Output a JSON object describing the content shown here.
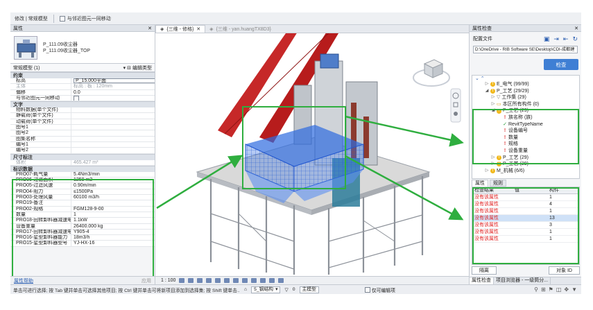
{
  "ribbon": {
    "context": "修改 | 常规模型",
    "checkbox_label": "与邻近图元一同移动"
  },
  "left_panel": {
    "header": "属性",
    "type_name_1": "P_111.09收尘器",
    "type_name_2": "P_111.09收尘器_TOP",
    "type_selector": "常规模型 (1)",
    "edit_type_label": "编辑类型",
    "groups": [
      {
        "name": "约束",
        "rows": [
          {
            "k": "标高",
            "v": "P_15.000平面",
            "input": true
          },
          {
            "k": "主体",
            "v": "标高 : 板 : 120mm",
            "grey": true
          },
          {
            "k": "偏移",
            "v": "0.0"
          },
          {
            "k": "与邻近图元一同移动",
            "v": "",
            "checkbox": true
          }
        ]
      },
      {
        "name": "文字",
        "rows": [
          {
            "k": "物料数据(单个文件)",
            "v": ""
          },
          {
            "k": "静载荷(单个文件)",
            "v": ""
          },
          {
            "k": "动载荷(单个文件)",
            "v": ""
          },
          {
            "k": "图号1",
            "v": ""
          },
          {
            "k": "图号2",
            "v": ""
          },
          {
            "k": "图集名称",
            "v": ""
          },
          {
            "k": "编号1",
            "v": ""
          },
          {
            "k": "编号2",
            "v": ""
          }
        ]
      },
      {
        "name": "尺寸标注",
        "rows": [
          {
            "k": "体积",
            "v": "465.427 m³",
            "grey": true
          }
        ]
      },
      {
        "name": "标识数据",
        "rows": [
          {
            "k": "PRO07-耗气量",
            "v": "5.4Nm3/min"
          },
          {
            "k": "PRO06-过滤面积",
            "v": "1259 m2"
          },
          {
            "k": "PRO05-过滤风速",
            "v": "0.90m/min"
          },
          {
            "k": "PRO04-阻力",
            "v": "≤1500Pa"
          },
          {
            "k": "PRO03-处理风量",
            "v": "60100 m3/h"
          },
          {
            "k": "PRO19-备注",
            "v": ""
          },
          {
            "k": "PRO02-规格",
            "v": "FGM128-9-00"
          },
          {
            "k": "数量",
            "v": "1"
          },
          {
            "k": "PRO18-回转卸料器减速电机...",
            "v": "1.1kW"
          },
          {
            "k": "设备重量",
            "v": "26400.000 kg"
          },
          {
            "k": "PRO17-回转卸料器减速电机...",
            "v": "Y905-4"
          },
          {
            "k": "PRO16-星型卸料器能力",
            "v": "18m3/h"
          },
          {
            "k": "PRO15-星型卸料器型号",
            "v": "YJ-HX-16"
          }
        ]
      }
    ],
    "help_link": "属性帮助",
    "apply": "应用"
  },
  "viewport": {
    "tab_active": "{三维 - 修格}",
    "tab_inactive": "{三维 - yan.huangTX8D3}",
    "scale": "1 : 100"
  },
  "right_panel": {
    "header": "属性检查",
    "config_label": "配置文件",
    "path": "D:\\OneDrive - RIB Software SE\\Desktop\\CDI-成都建",
    "check_button": "检查",
    "tree": [
      {
        "indent": 2,
        "icon": "warn",
        "text": "E_电气 (99/99)"
      },
      {
        "indent": 2,
        "icon": "warn",
        "text": "P_工艺 (29/29)",
        "open": true
      },
      {
        "indent": 3,
        "icon": "filter",
        "text": "工作集 (29)"
      },
      {
        "indent": 3,
        "icon": "folder",
        "text": "本区所有构件 (0)"
      },
      {
        "indent": 3,
        "icon": "warn",
        "text": "P_工艺 (29)",
        "open": true
      },
      {
        "indent": 4,
        "icon": "ex",
        "text": "族名称 (族)"
      },
      {
        "indent": 4,
        "icon": "ok",
        "text": "RevitTypeName"
      },
      {
        "indent": 4,
        "icon": "ex",
        "text": "设备编号"
      },
      {
        "indent": 4,
        "icon": "ex",
        "text": "数量"
      },
      {
        "indent": 4,
        "icon": "ex",
        "text": "规格"
      },
      {
        "indent": 4,
        "icon": "ex",
        "text": "设备重量"
      },
      {
        "indent": 3,
        "icon": "warn",
        "text": "P_工艺 (29)"
      },
      {
        "indent": 3,
        "icon": "warn",
        "text": "P_工艺 (29)"
      },
      {
        "indent": 2,
        "icon": "warn",
        "text": "M_机械 (6/6)"
      }
    ],
    "subtab_1": "属性",
    "subtab_2": "规则",
    "table_headers": [
      "检查结果",
      "值",
      "构件"
    ],
    "table_rows": [
      {
        "result": "没有该属性",
        "value": "",
        "count": "1"
      },
      {
        "result": "没有该属性",
        "value": "",
        "count": "4"
      },
      {
        "result": "没有该属性",
        "value": "",
        "count": "1"
      },
      {
        "result": "没有该属性",
        "value": "",
        "count": "13",
        "selected": true
      },
      {
        "result": "没有该属性",
        "value": "",
        "count": "3"
      },
      {
        "result": "没有该属性",
        "value": "",
        "count": "1"
      },
      {
        "result": "没有该属性",
        "value": "",
        "count": "1"
      }
    ],
    "btn_isolate": "隔离",
    "btn_object_id": "对象 ID",
    "bottom_tab_1": "属性检查",
    "bottom_tab_2": "项目浏览器 - 一级筒分..."
  },
  "status": {
    "message": "单击可进行选择; 按 Tab 键并单击可选择其他项目; 按 Ctrl 键并单击可将新项目添加到选择集; 按 Shift 键单击...",
    "workset": "5_钢结构",
    "filter_value": "0",
    "model_label": "主模型",
    "edit_only": "仅可编辑项"
  },
  "colors": {
    "highlight": "#2fae3f",
    "accent": "#3f7fd4",
    "error": "#e02222"
  }
}
